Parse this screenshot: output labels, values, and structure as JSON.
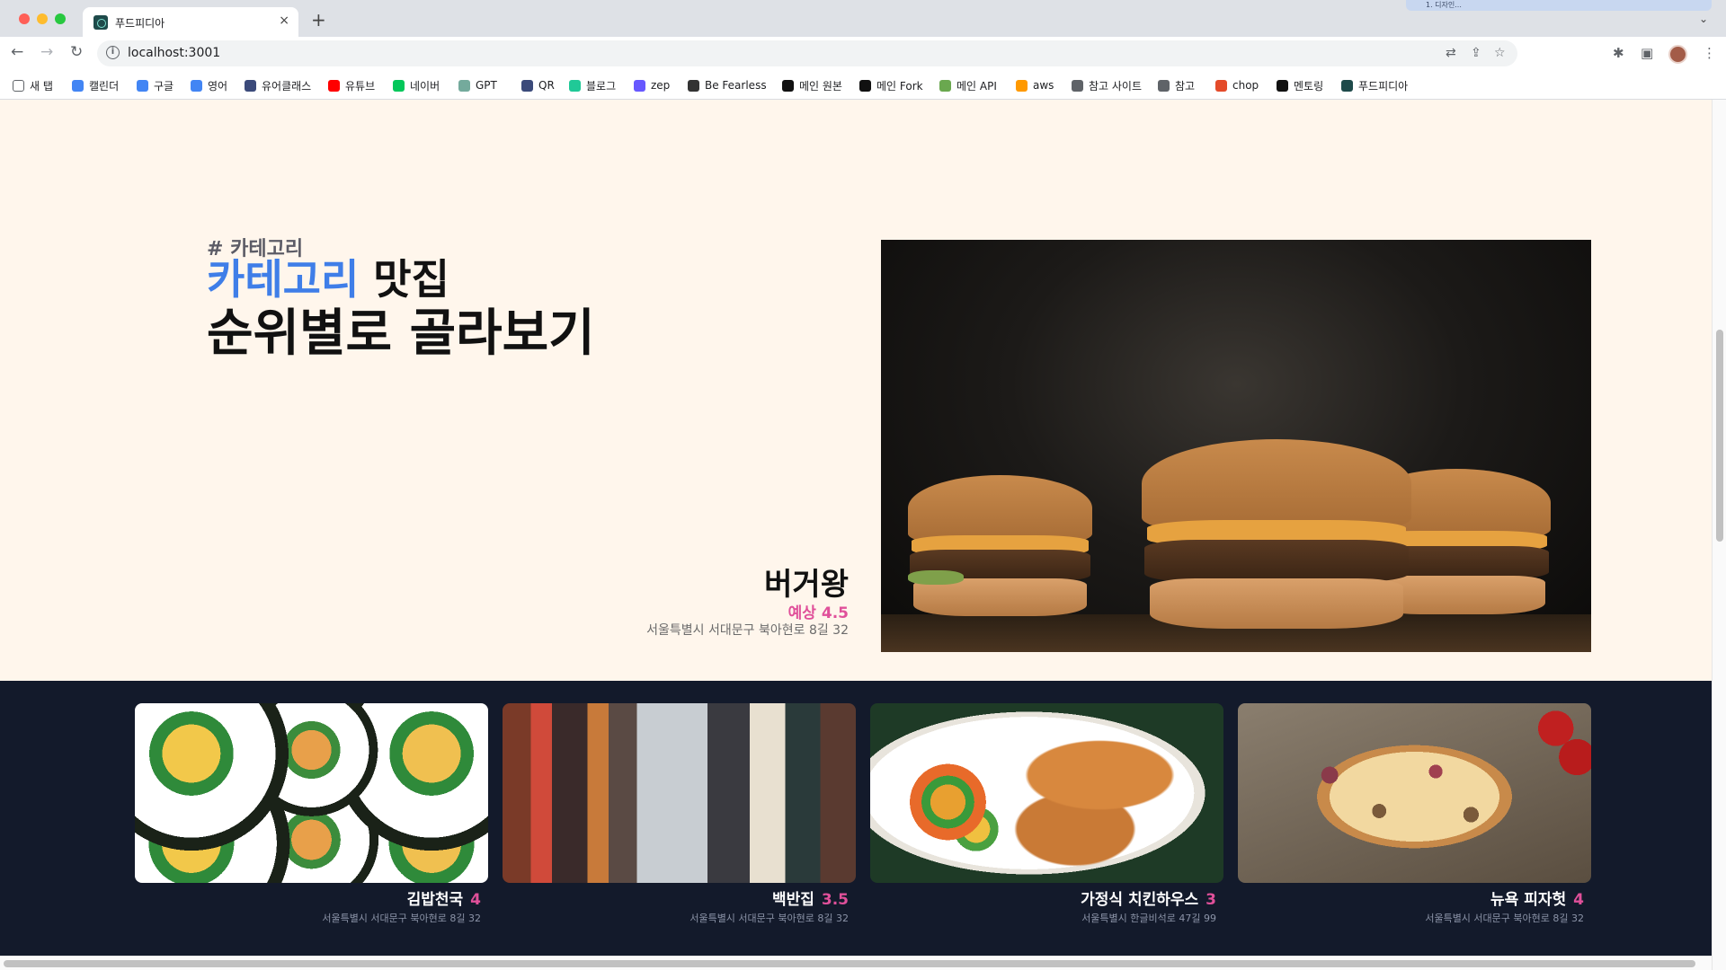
{
  "browser": {
    "tab_title": "푸드피디아",
    "tab_close": "×",
    "new_tab": "+",
    "ghost_tab": "1. 디자인...",
    "url": "localhost:3001",
    "bookmarks": [
      {
        "label": "새 탭",
        "icon": "square-outline-icon",
        "color": "#ffffff"
      },
      {
        "label": "캘린더",
        "icon": "calendar-icon",
        "color": "#4285f4"
      },
      {
        "label": "구글",
        "icon": "google-icon",
        "color": "#4285f4"
      },
      {
        "label": "영어",
        "icon": "google-icon",
        "color": "#4285f4"
      },
      {
        "label": "유어클래스",
        "icon": "class-icon",
        "color": "#3b4a7a"
      },
      {
        "label": "유튜브",
        "icon": "youtube-icon",
        "color": "#ff0000"
      },
      {
        "label": "네이버",
        "icon": "naver-icon",
        "color": "#03c75a"
      },
      {
        "label": "GPT",
        "icon": "openai-icon",
        "color": "#74aa9c"
      },
      {
        "label": "QR",
        "icon": "qr-icon",
        "color": "#3b4a7a"
      },
      {
        "label": "블로그",
        "icon": "velog-icon",
        "color": "#20c997"
      },
      {
        "label": "zep",
        "icon": "zep-icon",
        "color": "#6758ff"
      },
      {
        "label": "Be Fearless",
        "icon": "eye-icon",
        "color": "#333333"
      },
      {
        "label": "메인 원본",
        "icon": "github-icon",
        "color": "#111111"
      },
      {
        "label": "메인 Fork",
        "icon": "github-icon",
        "color": "#111111"
      },
      {
        "label": "메인 API",
        "icon": "puzzle-icon",
        "color": "#6aa84f"
      },
      {
        "label": "aws",
        "icon": "aws-cube-icon",
        "color": "#ff9900"
      },
      {
        "label": "참고 사이트",
        "icon": "folder-icon",
        "color": "#5f6368"
      },
      {
        "label": "참고",
        "icon": "folder-icon",
        "color": "#5f6368"
      },
      {
        "label": "chop",
        "icon": "apple-icon",
        "color": "#e44b2a"
      },
      {
        "label": "멘토링",
        "icon": "notion-icon",
        "color": "#111111"
      },
      {
        "label": "푸드피디아",
        "icon": "foodpedia-icon",
        "color": "#1e4a4a"
      }
    ]
  },
  "hero": {
    "subtitle": "# 카테고리",
    "title_accent": "카테고리",
    "title_rest": " 맛집",
    "title_line2": "순위별로 골라보기",
    "featured": {
      "name": "버거왕",
      "rating": "예상 4.5",
      "address": "서울특별시 서대문구 북아현로 8길 32"
    }
  },
  "cards": [
    {
      "name": "김밥천국",
      "rating": "4",
      "address": "서울특별시 서대문구 북아현로 8길 32",
      "image": "kimbap"
    },
    {
      "name": "백반집",
      "rating": "3.5",
      "address": "서울특별시 서대문구 북아현로 8길 32",
      "image": "street"
    },
    {
      "name": "가정식 치킨하우스",
      "rating": "3",
      "address": "서울특별시 한글비석로 47길 99",
      "image": "chicken"
    },
    {
      "name": "뉴욕 피자헛",
      "rating": "4",
      "address": "서울특별시 서대문구 북아현로 8길 32",
      "image": "pizza"
    }
  ],
  "colors": {
    "page_bg": "#fff6ec",
    "accent_blue": "#3f7ee8",
    "rating_pink": "#e0509a",
    "band_bg": "#131a2b"
  }
}
